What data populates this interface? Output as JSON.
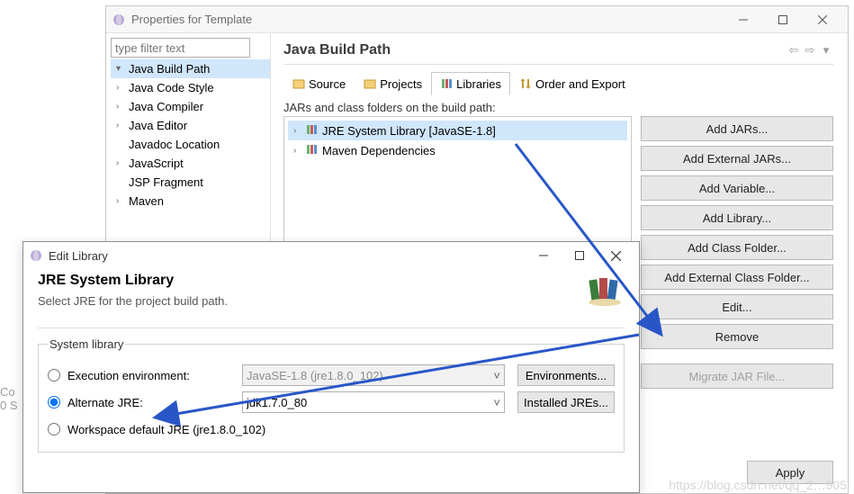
{
  "props": {
    "title": "Properties for Template",
    "filter_placeholder": "type filter text",
    "tree": [
      {
        "label": "Java Build Path",
        "exp": "▾",
        "sel": true
      },
      {
        "label": "Java Code Style",
        "exp": "›"
      },
      {
        "label": "Java Compiler",
        "exp": "›"
      },
      {
        "label": "Java Editor",
        "exp": "›"
      },
      {
        "label": "Javadoc Location",
        "exp": " "
      },
      {
        "label": "JavaScript",
        "exp": "›"
      },
      {
        "label": "JSP Fragment",
        "exp": " "
      },
      {
        "label": "Maven",
        "exp": "›"
      }
    ],
    "section_title": "Java Build Path",
    "tabs": [
      {
        "label": "Source",
        "active": false
      },
      {
        "label": "Projects",
        "active": false
      },
      {
        "label": "Libraries",
        "active": true
      },
      {
        "label": "Order and Export",
        "active": false
      }
    ],
    "sub_label": "JARs and class folders on the build path:",
    "libs": [
      {
        "label": "JRE System Library [JavaSE-1.8]",
        "sel": true
      },
      {
        "label": "Maven Dependencies",
        "sel": false
      }
    ],
    "buttons": {
      "add_jars": "Add JARs...",
      "add_ext_jars": "Add External JARs...",
      "add_var": "Add Variable...",
      "add_lib": "Add Library...",
      "add_class": "Add Class Folder...",
      "add_ext_class": "Add External Class Folder...",
      "edit": "Edit...",
      "remove": "Remove",
      "migrate": "Migrate JAR File..."
    },
    "apply": "Apply"
  },
  "edit": {
    "title": "Edit Library",
    "heading": "JRE System Library",
    "hint": "Select JRE for the project build path.",
    "group": "System library",
    "r1": {
      "label": "Execution environment:",
      "value": "JavaSE-1.8 (jre1.8.0_102)",
      "btn": "Environments..."
    },
    "r2": {
      "label": "Alternate JRE:",
      "value": "jdk1.7.0_80",
      "btn": "Installed JREs..."
    },
    "r3": {
      "label": "Workspace default JRE (jre1.8.0_102)"
    }
  },
  "bg": {
    "t1": "Co",
    "t2": "0 S"
  },
  "watermark": "https://blog.csdn.net/qq_2…905"
}
